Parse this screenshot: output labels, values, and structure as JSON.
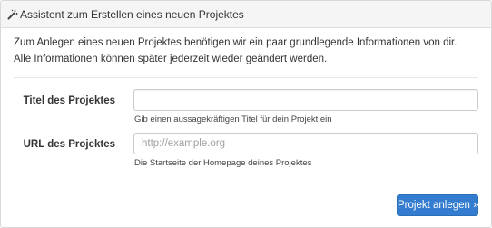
{
  "panel": {
    "icon": "magic-wand-icon",
    "title": "Assistent zum Erstellen eines neuen Projektes"
  },
  "intro": {
    "line1": "Zum Anlegen eines neuen Projektes benötigen wir ein paar grundlegende Informationen von dir.",
    "line2": "Alle Informationen können später jederzeit wieder geändert werden."
  },
  "form": {
    "title_field": {
      "label": "Titel des Projektes",
      "value": "",
      "placeholder": "",
      "help": "Gib einen aussagekräftigen Titel für dein Projekt ein"
    },
    "url_field": {
      "label": "URL des Projektes",
      "value": "",
      "placeholder": "http://example.org",
      "help": "Die Startseite der Homepage deines Projektes"
    },
    "submit_label": "Projekt anlegen »"
  },
  "colors": {
    "primary_button": "#337ccf",
    "heading_background": "#f5f5f5",
    "border": "#d9d9d9"
  }
}
